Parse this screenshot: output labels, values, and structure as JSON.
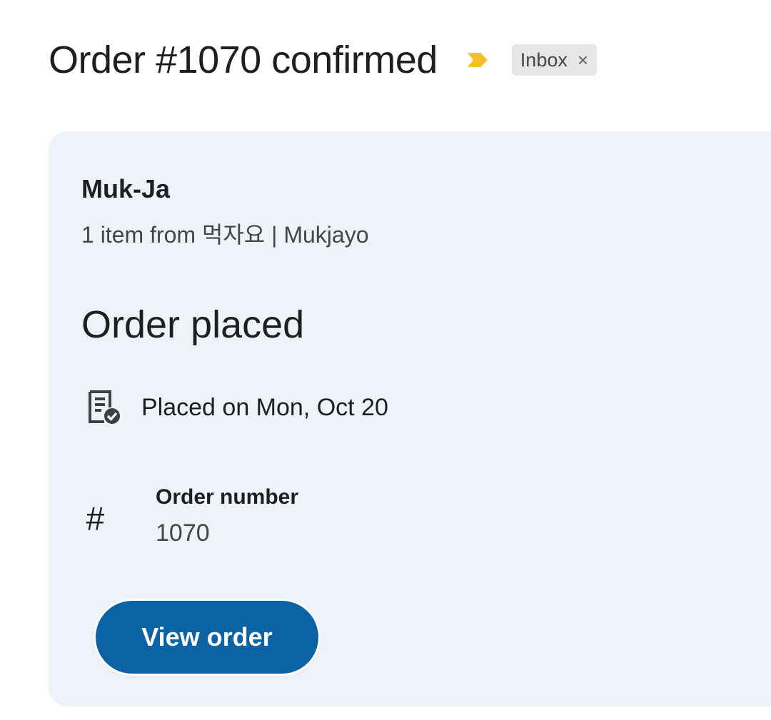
{
  "header": {
    "subject": "Order #1070 confirmed",
    "importance_icon": "importance-marker-icon",
    "label_chip": {
      "label": "Inbox",
      "close_glyph": "×"
    }
  },
  "card": {
    "merchant_name": "Muk-Ja",
    "items_summary": "1 item from 먹자요 | Mukjayo",
    "status_heading": "Order placed",
    "placed": {
      "icon": "receipt-check-icon",
      "text": "Placed on Mon, Oct 20"
    },
    "order_number": {
      "icon_glyph": "#",
      "label": "Order number",
      "value": "1070"
    },
    "view_order_button": "View order"
  },
  "colors": {
    "card_background": "#eef2f9",
    "button_background": "#0b62a5",
    "importance_marker": "#f6bf26",
    "chip_background": "#e6e6e6"
  }
}
